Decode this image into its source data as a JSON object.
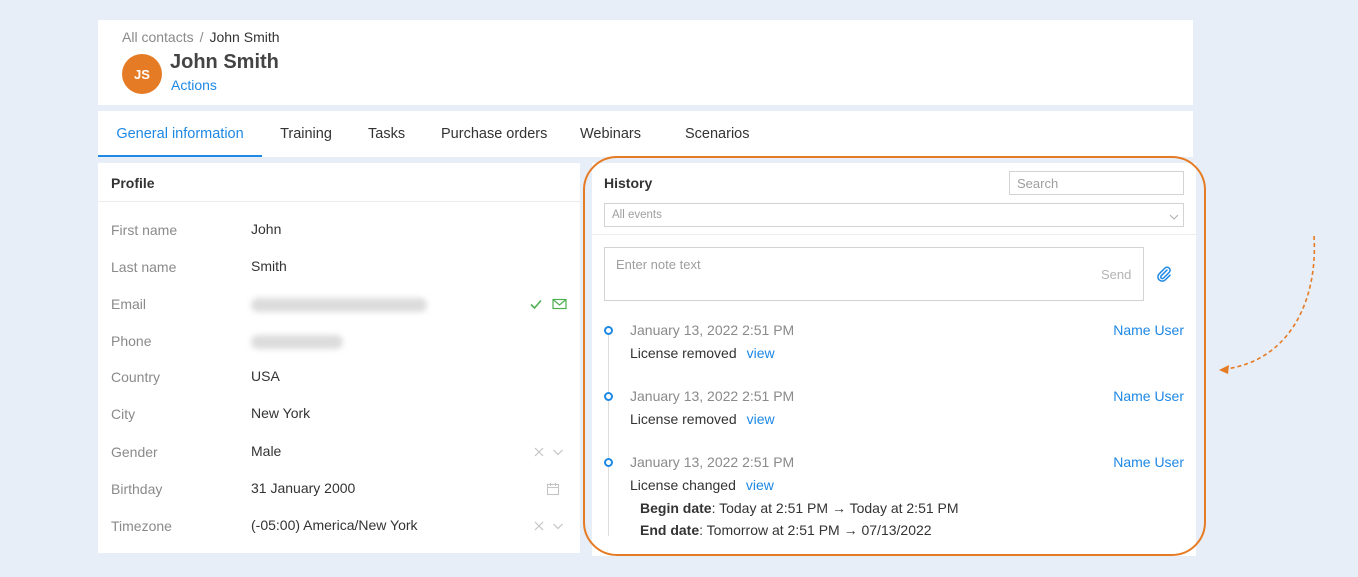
{
  "breadcrumb": {
    "root": "All contacts",
    "separator": "/",
    "current": "John Smith"
  },
  "contact": {
    "initials": "JS",
    "name": "John Smith",
    "actions_label": "Actions",
    "avatar_color": "#e57b24"
  },
  "tabs": [
    {
      "label": "General information",
      "active": true
    },
    {
      "label": "Training",
      "active": false
    },
    {
      "label": "Tasks",
      "active": false
    },
    {
      "label": "Purchase orders",
      "active": false
    },
    {
      "label": "Webinars",
      "active": false
    },
    {
      "label": "Scenarios",
      "active": false
    }
  ],
  "profile": {
    "title": "Profile",
    "fields": [
      {
        "label": "First name",
        "value": "John"
      },
      {
        "label": "Last name",
        "value": "Smith"
      },
      {
        "label": "Email",
        "value": "",
        "icons": [
          "verified-check-icon",
          "send-email-icon"
        ]
      },
      {
        "label": "Phone",
        "value": ""
      },
      {
        "label": "Country",
        "value": "USA"
      },
      {
        "label": "City",
        "value": "New York"
      },
      {
        "label": "Gender",
        "value": "Male",
        "icons": [
          "clear-icon",
          "chevron-down-icon"
        ]
      },
      {
        "label": "Birthday",
        "value": "31 January 2000",
        "icons": [
          "calendar-icon"
        ]
      },
      {
        "label": "Timezone",
        "value": "(-05:00) America/New York",
        "icons": [
          "clear-icon",
          "chevron-down-icon"
        ]
      }
    ]
  },
  "history": {
    "title": "History",
    "search_placeholder": "Search",
    "filter_value": "All events",
    "note_placeholder": "Enter note text",
    "send_label": "Send",
    "events": [
      {
        "date": "January 13, 2022 2:51 PM",
        "user": "Name User",
        "description": "License removed",
        "view_label": "view"
      },
      {
        "date": "January 13, 2022 2:51 PM",
        "user": "Name User",
        "description": "License removed",
        "view_label": "view"
      },
      {
        "date": "January 13, 2022 2:51 PM",
        "user": "Name User",
        "description": "License changed",
        "view_label": "view",
        "details": [
          {
            "key": "Begin date",
            "value": ": Today at 2:51 PM → Today at 2:51 PM"
          },
          {
            "key": "End date",
            "value": ": Tomorrow at 2:51 PM → 07/13/2022"
          }
        ]
      }
    ]
  },
  "colors": {
    "accent": "#1e88e5",
    "highlight": "#e57b24",
    "background": "#e7eef7",
    "verified": "#4caf50"
  }
}
